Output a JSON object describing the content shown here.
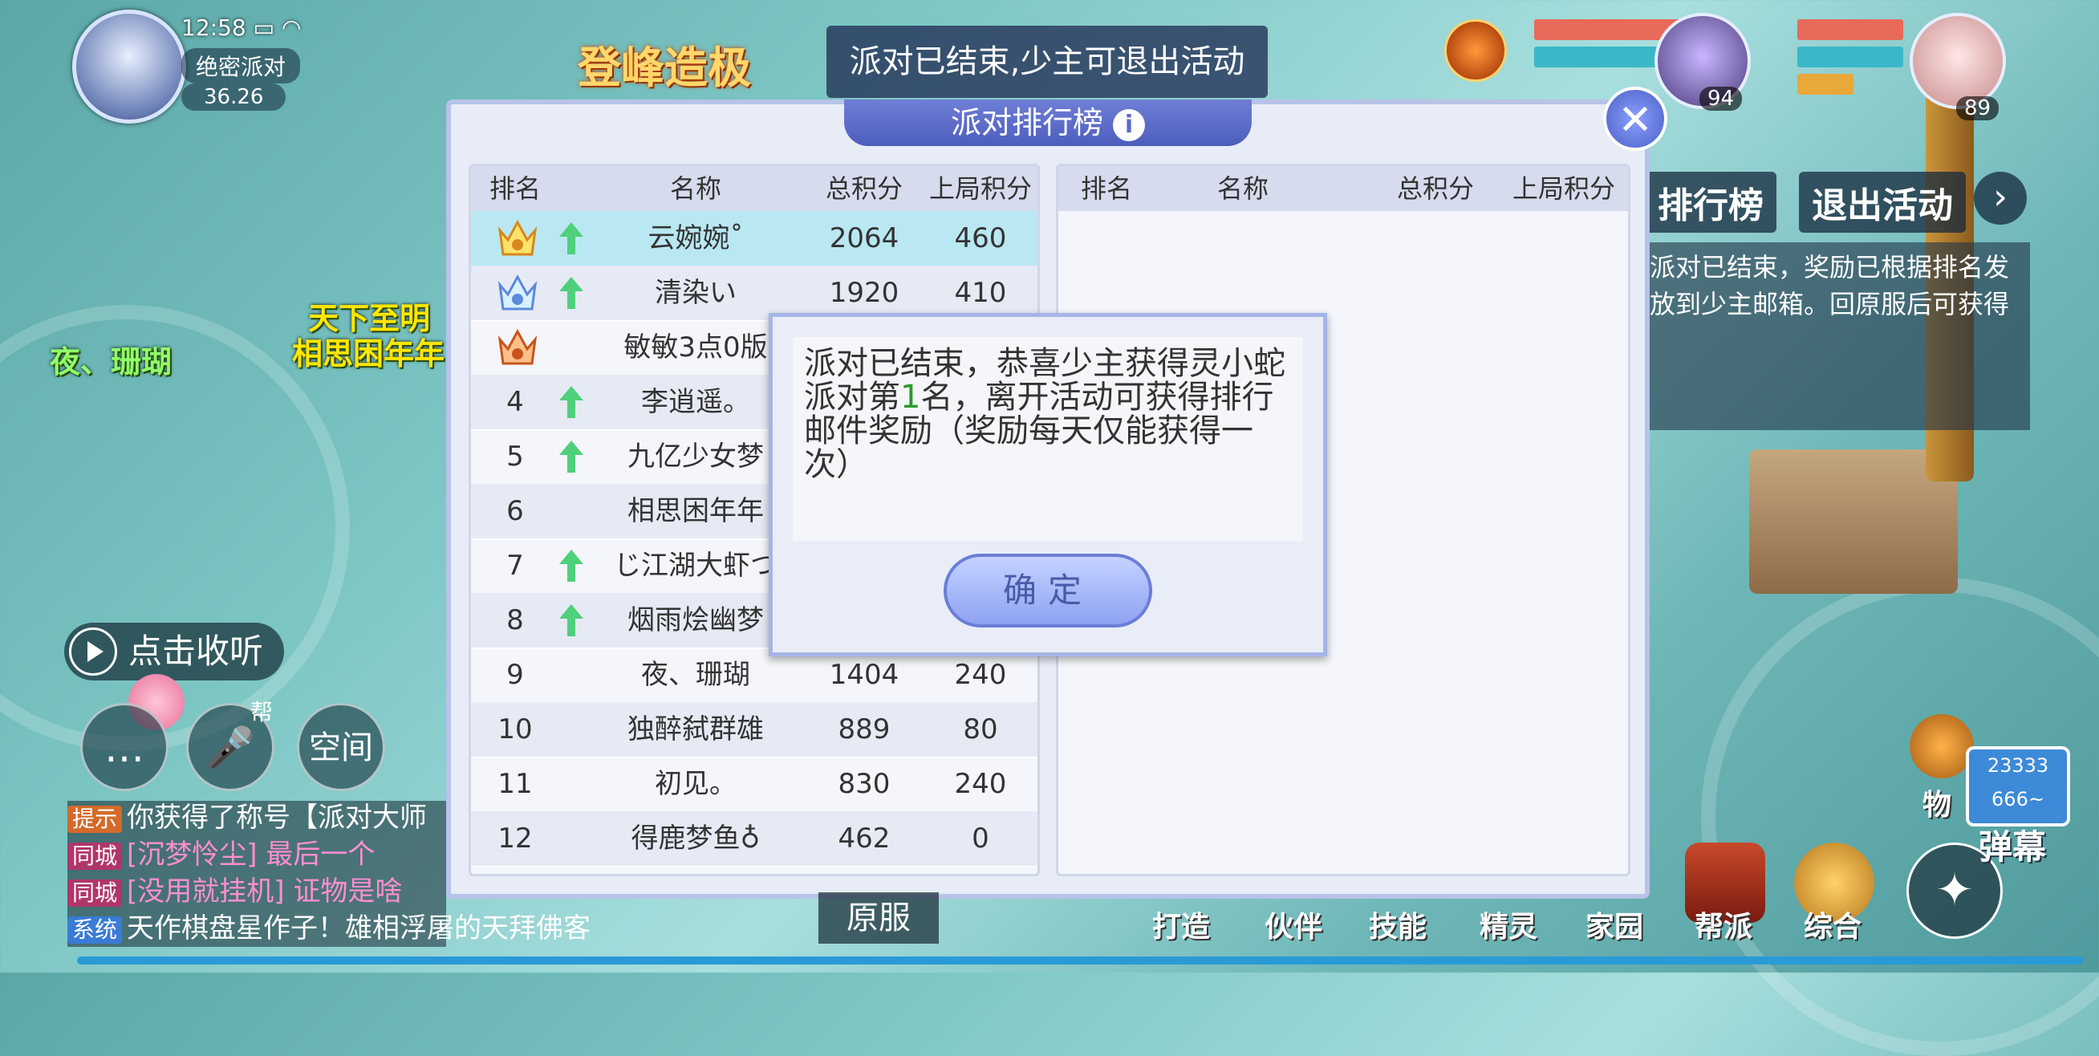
{
  "hud": {
    "time": "12:58",
    "map_name": "绝密派对",
    "coord": "36.26",
    "event_banner": "登峰造极",
    "broadcast": "派对已结束,少主可退出活动",
    "player_names": [
      "天下至明",
      "相思困年年",
      "夜、珊瑚"
    ],
    "team": [
      {
        "level": "94"
      },
      {
        "level": "89"
      }
    ]
  },
  "right_panel": {
    "ranking_button": "排行榜",
    "exit_button": "退出活动",
    "info_text": "派对已结束，奖励已根据排名发放到少主邮箱。回原服后可获得"
  },
  "dialog": {
    "title": "派对排行榜",
    "info_icon": "i",
    "close_icon": "✕",
    "headers": [
      "排名",
      "名称",
      "总积分",
      "上局积分"
    ],
    "left_rows": [
      {
        "rank": "",
        "crown": "gold",
        "arrow": true,
        "name": "云婉婉˚",
        "total": "2064",
        "last": "460"
      },
      {
        "rank": "",
        "crown": "silver",
        "arrow": true,
        "name": "清染い",
        "total": "1920",
        "last": "410"
      },
      {
        "rank": "",
        "crown": "bronze",
        "arrow": false,
        "name": "敏敏3点0版",
        "total": "",
        "last": ""
      },
      {
        "rank": "4",
        "crown": "",
        "arrow": true,
        "name": "李逍遥。",
        "total": "",
        "last": ""
      },
      {
        "rank": "5",
        "crown": "",
        "arrow": true,
        "name": "九亿少女梦",
        "total": "",
        "last": ""
      },
      {
        "rank": "6",
        "crown": "",
        "arrow": false,
        "name": "相思困年年",
        "total": "",
        "last": ""
      },
      {
        "rank": "7",
        "crown": "",
        "arrow": true,
        "name": "じ江湖大虾つ",
        "total": "",
        "last": ""
      },
      {
        "rank": "8",
        "crown": "",
        "arrow": true,
        "name": "烟雨烩幽梦",
        "total": "",
        "last": ""
      },
      {
        "rank": "9",
        "crown": "",
        "arrow": false,
        "name": "夜、珊瑚",
        "total": "1404",
        "last": "240"
      },
      {
        "rank": "10",
        "crown": "",
        "arrow": false,
        "name": "独醉弑群雄",
        "total": "889",
        "last": "80"
      },
      {
        "rank": "11",
        "crown": "",
        "arrow": false,
        "name": "初见。",
        "total": "830",
        "last": "240"
      },
      {
        "rank": "12",
        "crown": "",
        "arrow": false,
        "name": "得鹿梦鱼♁",
        "total": "462",
        "last": "0"
      }
    ]
  },
  "message": {
    "text_before": "派对已结束，恭喜少主获得灵小蛇派对第",
    "rank": "1",
    "text_after": "名，离开活动可获得排行邮件奖励（奖励每天仅能获得一次）",
    "ok_button": "确定"
  },
  "chat": {
    "listen_button": "点击收听",
    "voice_label": "帮",
    "space_label": "空间",
    "lines": [
      {
        "tag": "提示",
        "tag_color": "#d46a2a",
        "text": "你获得了称号【派对大师",
        "color": "#ffffff"
      },
      {
        "tag": "同城",
        "tag_color": "#b0366a",
        "text": "[沉梦怜尘] 最后一个",
        "color": "#ff8ed0"
      },
      {
        "tag": "同城",
        "tag_color": "#b0366a",
        "text": "[没用就挂机] 证物是啥",
        "color": "#ff8ed0"
      },
      {
        "tag": "系统",
        "tag_color": "#3a7bd5",
        "text": "天作棋盘星作子！雄相浮屠的天拜佛客",
        "color": "#ffffff"
      }
    ]
  },
  "bottom_nav": [
    "原服",
    "打造",
    "伙伴",
    "技能",
    "精灵",
    "家园",
    "帮派",
    "综合"
  ],
  "danmu": {
    "label": "弹幕",
    "count": "23333",
    "sub": "666~",
    "item": "物"
  }
}
